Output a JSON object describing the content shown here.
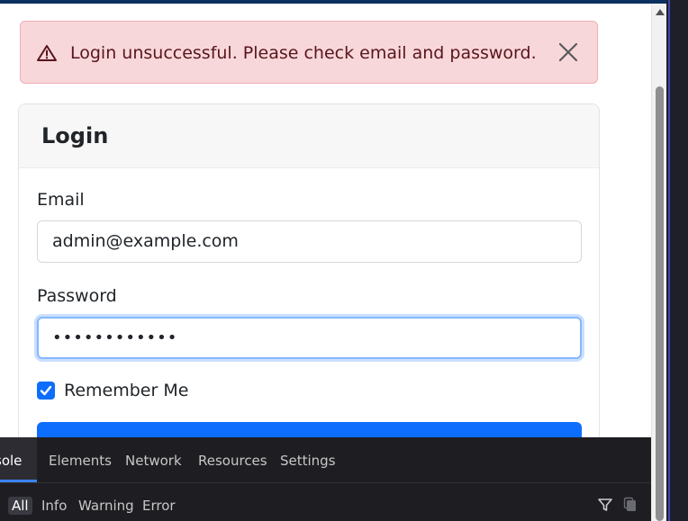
{
  "alert": {
    "message": "Login unsuccessful. Please check email and password.",
    "icon": "warning-triangle-icon",
    "close_icon": "close-icon",
    "colors": {
      "background": "#f8d7da",
      "border": "#f1aeb5",
      "text": "#58151c"
    }
  },
  "login": {
    "title": "Login",
    "email_label": "Email",
    "email_value": "admin@example.com",
    "password_label": "Password",
    "password_value": "••••••••••••",
    "remember_label": "Remember Me",
    "remember_checked": true,
    "accent": "#0d6efd"
  },
  "devtools": {
    "tabs": [
      {
        "label": "sole",
        "active": true
      },
      {
        "label": "Elements"
      },
      {
        "label": "Network"
      },
      {
        "label": "Resources"
      },
      {
        "label": "Settings"
      }
    ],
    "filters": [
      {
        "label": "All",
        "active": true
      },
      {
        "label": "Info"
      },
      {
        "label": "Warning"
      },
      {
        "label": "Error"
      }
    ],
    "icons": [
      "filter-icon",
      "copy-icon"
    ]
  }
}
